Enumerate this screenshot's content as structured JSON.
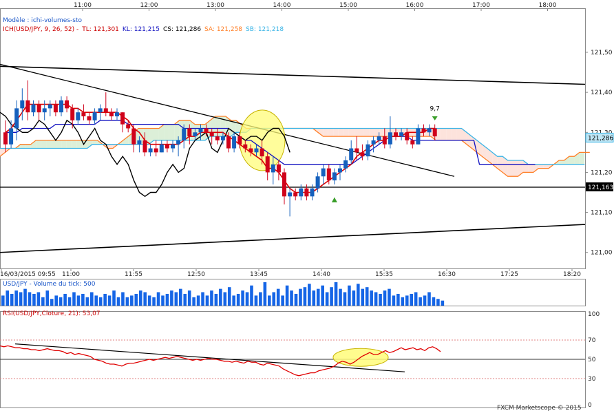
{
  "chart_data": [
    {
      "type": "candlestick",
      "title": "Modèle : ichi-volumes-sto",
      "legend": [
        {
          "text": "ICH(USD/JPY, 9, 26, 52) -",
          "color": "#cc0000"
        },
        {
          "text": "TL: 121,301",
          "color": "#cc0000"
        },
        {
          "text": "KL: 121,215",
          "color": "#1010c0"
        },
        {
          "text": "CS: 121,286",
          "color": "#000000"
        },
        {
          "text": "SA: 121,258",
          "color": "#ff7f27"
        },
        {
          "text": "SB: 121,218",
          "color": "#3ab4e6"
        }
      ],
      "top_time_labels": [
        "11:00",
        "12:00",
        "13:00",
        "14:00",
        "15:00",
        "16:00",
        "17:00",
        "18:00"
      ],
      "bottom_time_labels": [
        "16/03/2015 09:55",
        "11:00",
        "11:55",
        "12:50",
        "13:45",
        "14:40",
        "15:35",
        "16:30",
        "17:25",
        "18:20"
      ],
      "y_ticks": [
        "121,50",
        "121,40",
        "121,30",
        "121,20",
        "121,10",
        "121,00"
      ],
      "ylim": [
        120.96,
        121.61
      ],
      "last_price_label": "121,286",
      "support_label": "121,163",
      "support_level": 121.163,
      "annotation": "9,7",
      "candles": [
        [
          121.3,
          121.33,
          121.25,
          121.27
        ],
        [
          121.27,
          121.33,
          121.26,
          121.31
        ],
        [
          121.31,
          121.38,
          121.28,
          121.36
        ],
        [
          121.36,
          121.41,
          121.33,
          121.38
        ],
        [
          121.38,
          121.43,
          121.33,
          121.35
        ],
        [
          121.35,
          121.38,
          121.34,
          121.37
        ],
        [
          121.37,
          121.38,
          121.33,
          121.35
        ],
        [
          121.35,
          121.38,
          121.33,
          121.36
        ],
        [
          121.36,
          121.38,
          121.34,
          121.37
        ],
        [
          121.37,
          121.38,
          121.34,
          121.35
        ],
        [
          121.35,
          121.39,
          121.34,
          121.38
        ],
        [
          121.38,
          121.39,
          121.35,
          121.36
        ],
        [
          121.36,
          121.37,
          121.31,
          121.33
        ],
        [
          121.33,
          121.36,
          121.32,
          121.35
        ],
        [
          121.35,
          121.37,
          121.33,
          121.34
        ],
        [
          121.34,
          121.35,
          121.32,
          121.33
        ],
        [
          121.33,
          121.36,
          121.32,
          121.35
        ],
        [
          121.35,
          121.37,
          121.33,
          121.36
        ],
        [
          121.36,
          121.4,
          121.34,
          121.35
        ],
        [
          121.35,
          121.36,
          121.33,
          121.34
        ],
        [
          121.34,
          121.36,
          121.33,
          121.35
        ],
        [
          121.35,
          121.35,
          121.3,
          121.32
        ],
        [
          121.32,
          121.33,
          121.3,
          121.31
        ],
        [
          121.31,
          121.32,
          121.25,
          121.27
        ],
        [
          121.27,
          121.29,
          121.25,
          121.28
        ],
        [
          121.28,
          121.3,
          121.24,
          121.25
        ],
        [
          121.25,
          121.27,
          121.24,
          121.26
        ],
        [
          121.26,
          121.28,
          121.24,
          121.25
        ],
        [
          121.25,
          121.28,
          121.25,
          121.27
        ],
        [
          121.27,
          121.28,
          121.25,
          121.26
        ],
        [
          121.26,
          121.28,
          121.25,
          121.27
        ],
        [
          121.27,
          121.29,
          121.24,
          121.28
        ],
        [
          121.28,
          121.32,
          121.26,
          121.31
        ],
        [
          121.31,
          121.32,
          121.27,
          121.29
        ],
        [
          121.29,
          121.31,
          121.28,
          121.3
        ],
        [
          121.3,
          121.32,
          121.28,
          121.31
        ],
        [
          121.31,
          121.32,
          121.29,
          121.3
        ],
        [
          121.3,
          121.31,
          121.27,
          121.29
        ],
        [
          121.29,
          121.31,
          121.27,
          121.28
        ],
        [
          121.28,
          121.3,
          121.27,
          121.29
        ],
        [
          121.29,
          121.3,
          121.25,
          121.26
        ],
        [
          121.26,
          121.3,
          121.25,
          121.29
        ],
        [
          121.29,
          121.3,
          121.26,
          121.27
        ],
        [
          121.27,
          121.28,
          121.25,
          121.26
        ],
        [
          121.26,
          121.27,
          121.24,
          121.25
        ],
        [
          121.25,
          121.27,
          121.24,
          121.26
        ],
        [
          121.26,
          121.28,
          121.22,
          121.24
        ],
        [
          121.24,
          121.25,
          121.18,
          121.2
        ],
        [
          121.2,
          121.24,
          121.17,
          121.22
        ],
        [
          121.22,
          121.23,
          121.18,
          121.2
        ],
        [
          121.2,
          121.21,
          121.12,
          121.14
        ],
        [
          121.14,
          121.16,
          121.09,
          121.15
        ],
        [
          121.15,
          121.16,
          121.13,
          121.14
        ],
        [
          121.14,
          121.17,
          121.13,
          121.16
        ],
        [
          121.16,
          121.17,
          121.13,
          121.14
        ],
        [
          121.14,
          121.17,
          121.13,
          121.16
        ],
        [
          121.16,
          121.2,
          121.15,
          121.19
        ],
        [
          121.19,
          121.22,
          121.17,
          121.21
        ],
        [
          121.21,
          121.22,
          121.17,
          121.18
        ],
        [
          121.18,
          121.21,
          121.17,
          121.2
        ],
        [
          121.2,
          121.22,
          121.18,
          121.21
        ],
        [
          121.21,
          121.24,
          121.2,
          121.23
        ],
        [
          121.23,
          121.28,
          121.22,
          121.26
        ],
        [
          121.26,
          121.29,
          121.23,
          121.25
        ],
        [
          121.25,
          121.27,
          121.23,
          121.24
        ],
        [
          121.24,
          121.28,
          121.23,
          121.27
        ],
        [
          121.27,
          121.29,
          121.25,
          121.28
        ],
        [
          121.28,
          121.3,
          121.27,
          121.29
        ],
        [
          121.29,
          121.31,
          121.26,
          121.27
        ],
        [
          121.27,
          121.34,
          121.26,
          121.3
        ],
        [
          121.3,
          121.31,
          121.28,
          121.29
        ],
        [
          121.29,
          121.31,
          121.28,
          121.3
        ],
        [
          121.3,
          121.31,
          121.27,
          121.28
        ],
        [
          121.28,
          121.29,
          121.26,
          121.27
        ],
        [
          121.27,
          121.32,
          121.27,
          121.31
        ],
        [
          121.31,
          121.32,
          121.29,
          121.3
        ],
        [
          121.3,
          121.32,
          121.29,
          121.31
        ],
        [
          121.31,
          121.32,
          121.28,
          121.29
        ]
      ],
      "tenkan": [
        121.3,
        121.31,
        121.33,
        121.35,
        121.37,
        121.37,
        121.37,
        121.37,
        121.37,
        121.37,
        121.37,
        121.37,
        121.36,
        121.36,
        121.35,
        121.35,
        121.35,
        121.35,
        121.35,
        121.35,
        121.35,
        121.34,
        121.33,
        121.31,
        121.3,
        121.28,
        121.27,
        121.27,
        121.27,
        121.27,
        121.27,
        121.27,
        121.28,
        121.29,
        121.29,
        121.3,
        121.3,
        121.3,
        121.3,
        121.3,
        121.29,
        121.28,
        121.27,
        121.26,
        121.25,
        121.24,
        121.23,
        121.21,
        121.21,
        121.2,
        121.18,
        121.16,
        121.15,
        121.15,
        121.15,
        121.15,
        121.16,
        121.17,
        121.18,
        121.19,
        121.2,
        121.21,
        121.22,
        121.24,
        121.25,
        121.26,
        121.27,
        121.28,
        121.28,
        121.29,
        121.29,
        121.29,
        121.3,
        121.3,
        121.3,
        121.3,
        121.31,
        121.31
      ],
      "kijun": [
        121.3,
        121.3,
        121.3,
        121.31,
        121.31,
        121.31,
        121.31,
        121.31,
        121.31,
        121.32,
        121.32,
        121.32,
        121.32,
        121.32,
        121.32,
        121.32,
        121.32,
        121.33,
        121.33,
        121.33,
        121.33,
        121.33,
        121.32,
        121.32,
        121.32,
        121.32,
        121.32,
        121.32,
        121.32,
        121.32,
        121.32,
        121.32,
        121.31,
        121.31,
        121.31,
        121.31,
        121.31,
        121.31,
        121.31,
        121.31,
        121.31,
        121.3,
        121.29,
        121.28,
        121.28,
        121.27,
        121.26,
        121.25,
        121.24,
        121.23,
        121.22,
        121.22,
        121.22,
        121.22,
        121.22,
        121.22,
        121.22,
        121.22,
        121.22,
        121.22,
        121.22,
        121.22,
        121.22,
        121.23,
        121.24,
        121.25,
        121.26,
        121.27,
        121.28,
        121.29,
        121.29,
        121.29,
        121.29,
        121.28,
        121.28,
        121.28,
        121.28,
        121.28,
        121.28,
        121.28,
        121.28,
        121.28,
        121.28,
        121.28,
        121.28,
        121.22,
        121.22,
        121.22,
        121.22,
        121.22,
        121.22,
        121.22,
        121.22,
        121.22,
        121.22,
        121.22
      ],
      "chikou": [
        121.35,
        121.34,
        121.32,
        121.31,
        121.3,
        121.3,
        121.31,
        121.33,
        121.32,
        121.3,
        121.28,
        121.3,
        121.33,
        121.32,
        121.3,
        121.27,
        121.29,
        121.31,
        121.28,
        121.27,
        121.24,
        121.22,
        121.24,
        121.22,
        121.18,
        121.15,
        121.14,
        121.15,
        121.15,
        121.17,
        121.2,
        121.22,
        121.2,
        121.21,
        121.26,
        121.28,
        121.29,
        121.3,
        121.26,
        121.25,
        121.28,
        121.31,
        121.3,
        121.29,
        121.28,
        121.29,
        121.29,
        121.28,
        121.3,
        121.31,
        121.31,
        121.29,
        121.25
      ],
      "senkou_a": [
        121.24,
        121.25,
        121.26,
        121.26,
        121.27,
        121.27,
        121.27,
        121.28,
        121.28,
        121.28,
        121.28,
        121.28,
        121.28,
        121.28,
        121.28,
        121.28,
        121.28,
        121.28,
        121.28,
        121.28,
        121.27,
        121.26,
        121.26,
        121.27,
        121.28,
        121.29,
        121.3,
        121.31,
        121.31,
        121.31,
        121.31,
        121.31,
        121.32,
        121.32,
        121.32,
        121.33,
        121.33,
        121.33,
        121.32,
        121.32,
        121.32,
        121.33,
        121.34,
        121.34,
        121.34,
        121.33,
        121.33,
        121.32,
        121.31,
        121.31,
        121.31,
        121.31,
        121.31,
        121.31,
        121.31,
        121.31,
        121.31,
        121.31,
        121.31,
        121.31,
        121.31,
        121.31,
        121.3,
        121.29,
        121.29,
        121.29,
        121.29,
        121.29,
        121.29,
        121.29,
        121.29,
        121.29,
        121.29,
        121.29,
        121.29,
        121.29,
        121.29,
        121.29,
        121.29,
        121.29,
        121.29,
        121.29,
        121.29,
        121.29,
        121.29,
        121.28,
        121.28,
        121.28,
        121.28,
        121.28,
        121.28,
        121.27,
        121.26,
        121.25,
        121.24,
        121.23,
        121.22,
        121.21,
        121.2,
        121.19,
        121.19,
        121.19,
        121.2,
        121.2,
        121.2,
        121.21,
        121.21,
        121.21,
        121.22,
        121.23,
        121.23,
        121.24,
        121.24,
        121.25,
        121.25,
        121.25
      ],
      "senkou_b": [
        121.26,
        121.26,
        121.26,
        121.26,
        121.26,
        121.26,
        121.26,
        121.26,
        121.26,
        121.26,
        121.26,
        121.26,
        121.26,
        121.26,
        121.26,
        121.26,
        121.26,
        121.26,
        121.27,
        121.27,
        121.27,
        121.27,
        121.27,
        121.27,
        121.27,
        121.27,
        121.27,
        121.27,
        121.27,
        121.27,
        121.28,
        121.28,
        121.28,
        121.28,
        121.28,
        121.28,
        121.28,
        121.28,
        121.28,
        121.28,
        121.28,
        121.29,
        121.29,
        121.29,
        121.29,
        121.29,
        121.3,
        121.3,
        121.3,
        121.31,
        121.31,
        121.31,
        121.31,
        121.31,
        121.31,
        121.31,
        121.31,
        121.31,
        121.31,
        121.31,
        121.31,
        121.31,
        121.31,
        121.31,
        121.31,
        121.31,
        121.31,
        121.31,
        121.31,
        121.31,
        121.31,
        121.31,
        121.31,
        121.31,
        121.31,
        121.31,
        121.31,
        121.31,
        121.31,
        121.31,
        121.31,
        121.31,
        121.31,
        121.31,
        121.31,
        121.31,
        121.31,
        121.31,
        121.31,
        121.31,
        121.31,
        121.3,
        121.29,
        121.28,
        121.27,
        121.26,
        121.25,
        121.24,
        121.24,
        121.23,
        121.23,
        121.23,
        121.23,
        121.22,
        121.22,
        121.22,
        121.22,
        121.22,
        121.22,
        121.22,
        121.22,
        121.22,
        121.22,
        121.22,
        121.22
      ]
    },
    {
      "type": "bar",
      "title": "USD/JPY - Volume du tick: 500",
      "values": [
        6,
        9,
        7,
        9,
        8,
        10,
        8,
        7,
        8,
        5,
        9,
        4,
        6,
        5,
        7,
        5,
        8,
        6,
        7,
        5,
        8,
        6,
        5,
        7,
        6,
        9,
        5,
        8,
        5,
        6,
        7,
        9,
        8,
        6,
        5,
        8,
        6,
        7,
        9,
        8,
        10,
        7,
        9,
        5,
        6,
        8,
        6,
        9,
        7,
        10,
        8,
        11,
        6,
        7,
        9,
        8,
        12,
        6,
        8,
        14,
        6,
        8,
        10,
        6,
        12,
        9,
        7,
        10,
        11,
        13,
        9,
        10,
        12,
        8,
        11,
        14,
        10,
        8,
        12,
        9,
        13,
        10,
        11,
        9,
        8,
        7,
        9,
        10,
        6,
        7,
        5,
        6,
        7,
        8,
        5,
        6,
        8,
        5,
        4,
        3
      ],
      "ylim": [
        0,
        16
      ]
    },
    {
      "type": "line",
      "title": "RSI(USD/JPY,Cloture, 21): 53,07",
      "y_ticks": [
        "100",
        "70",
        "50",
        "30",
        "0"
      ],
      "ylim": [
        0,
        100
      ],
      "levels": [
        70,
        50,
        30
      ],
      "values": [
        64,
        63,
        64,
        63,
        62,
        62,
        61,
        61,
        60,
        60,
        59,
        60,
        61,
        60,
        59,
        59,
        58,
        56,
        57,
        55,
        56,
        55,
        54,
        53,
        50,
        49,
        48,
        46,
        45,
        45,
        44,
        43,
        45,
        46,
        46,
        47,
        48,
        49,
        50,
        49,
        50,
        51,
        52,
        51,
        52,
        53,
        52,
        51,
        50,
        49,
        50,
        49,
        50,
        51,
        50,
        50,
        49,
        48,
        48,
        47,
        48,
        47,
        46,
        48,
        47,
        47,
        45,
        44,
        46,
        45,
        44,
        43,
        40,
        38,
        36,
        34,
        33,
        34,
        35,
        36,
        36,
        38,
        39,
        40,
        41,
        43,
        46,
        48,
        47,
        45,
        47,
        50,
        53,
        55,
        57,
        55,
        55,
        57,
        59,
        57,
        58,
        60,
        62,
        60,
        61,
        62,
        60,
        61,
        59,
        62,
        63,
        61,
        58
      ],
      "trendline": [
        [
          0.0,
          66
        ],
        [
          1.0,
          37
        ]
      ],
      "footer": "FXCM Marketscope © 2015"
    }
  ]
}
